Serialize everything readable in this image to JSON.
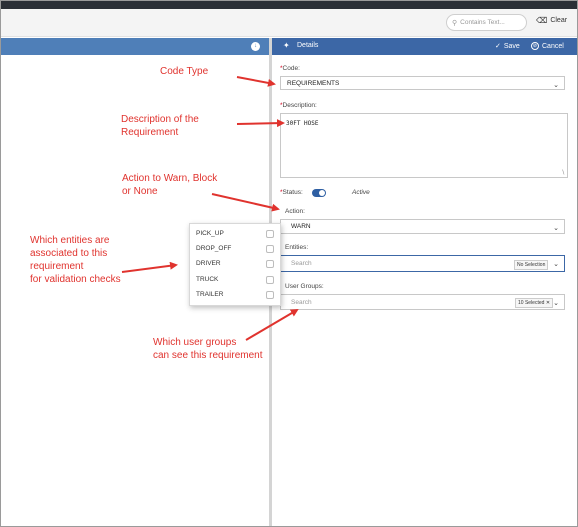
{
  "toolbar": {
    "search_placeholder": "Contains Text...",
    "clear_label": "Clear"
  },
  "details_panel": {
    "title": "Details",
    "save_label": "Save",
    "cancel_label": "Cancel"
  },
  "form": {
    "code_label": "Code:",
    "code_value": "REQUIREMENTS",
    "description_label": "Description:",
    "description_value": "30FT HOSE",
    "status_label": "Status:",
    "status_value": "Active",
    "status_on": true,
    "action_label": "Action:",
    "action_value": "WARN",
    "entities_label": "Entities:",
    "entities_placeholder": "Search",
    "entities_badge": "No Selection",
    "user_groups_label": "User Groups:",
    "user_groups_placeholder": "Search",
    "user_groups_badge": "10 Selected"
  },
  "entities_dropdown": {
    "options": [
      "PICK_UP",
      "DROP_OFF",
      "DRIVER",
      "TRUCK",
      "TRAILER"
    ]
  },
  "annotations": {
    "code_type": "Code Type",
    "description_line1": "Description of the",
    "description_line2": "Requirement",
    "action_line1": "Action to Warn, Block",
    "action_line2": "or None",
    "entities_line1": "Which entities are",
    "entities_line2": "associated to this",
    "entities_line3": "requirement",
    "entities_line4": "for validation checks",
    "groups_line1": "Which user groups",
    "groups_line2": "can see this requirement"
  },
  "colors": {
    "header_blue": "#3c67a6",
    "left_header_blue": "#4f7fb8",
    "annotation_red": "#e0332e",
    "required_red": "#d0021b"
  },
  "icons": [
    "search-icon",
    "eraser-icon",
    "download-icon",
    "pin-icon",
    "check-icon",
    "cancel-circle-icon",
    "chevron-down-icon",
    "resize-grip-icon",
    "close-x-icon"
  ]
}
